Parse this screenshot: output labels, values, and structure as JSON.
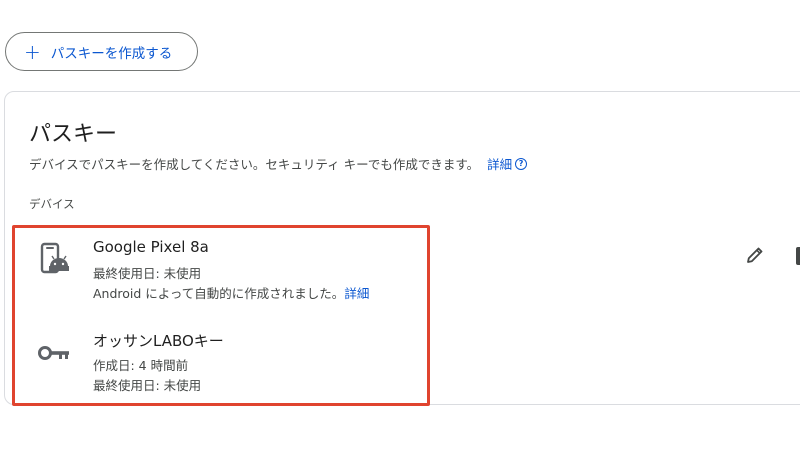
{
  "create_button": {
    "label": "パスキーを作成する",
    "icon": "plus-icon"
  },
  "card": {
    "title": "パスキー",
    "description": "デバイスでパスキーを作成してください。セキュリティ キーでも作成できます。",
    "learn_more": "詳細",
    "section_label": "デバイス"
  },
  "passkeys": [
    {
      "name": "Google Pixel 8a",
      "icon": "android-phone-icon",
      "meta1": "最終使用日: 未使用",
      "meta2": "Android によって自動的に作成されました。",
      "meta2_link": "詳細"
    },
    {
      "name": "オッサンLABOキー",
      "icon": "key-icon",
      "meta1": "作成日: 4 時間前",
      "meta2": "最終使用日: 未使用"
    }
  ],
  "colors": {
    "accent": "#0b57d0",
    "highlight": "#e0442f"
  }
}
